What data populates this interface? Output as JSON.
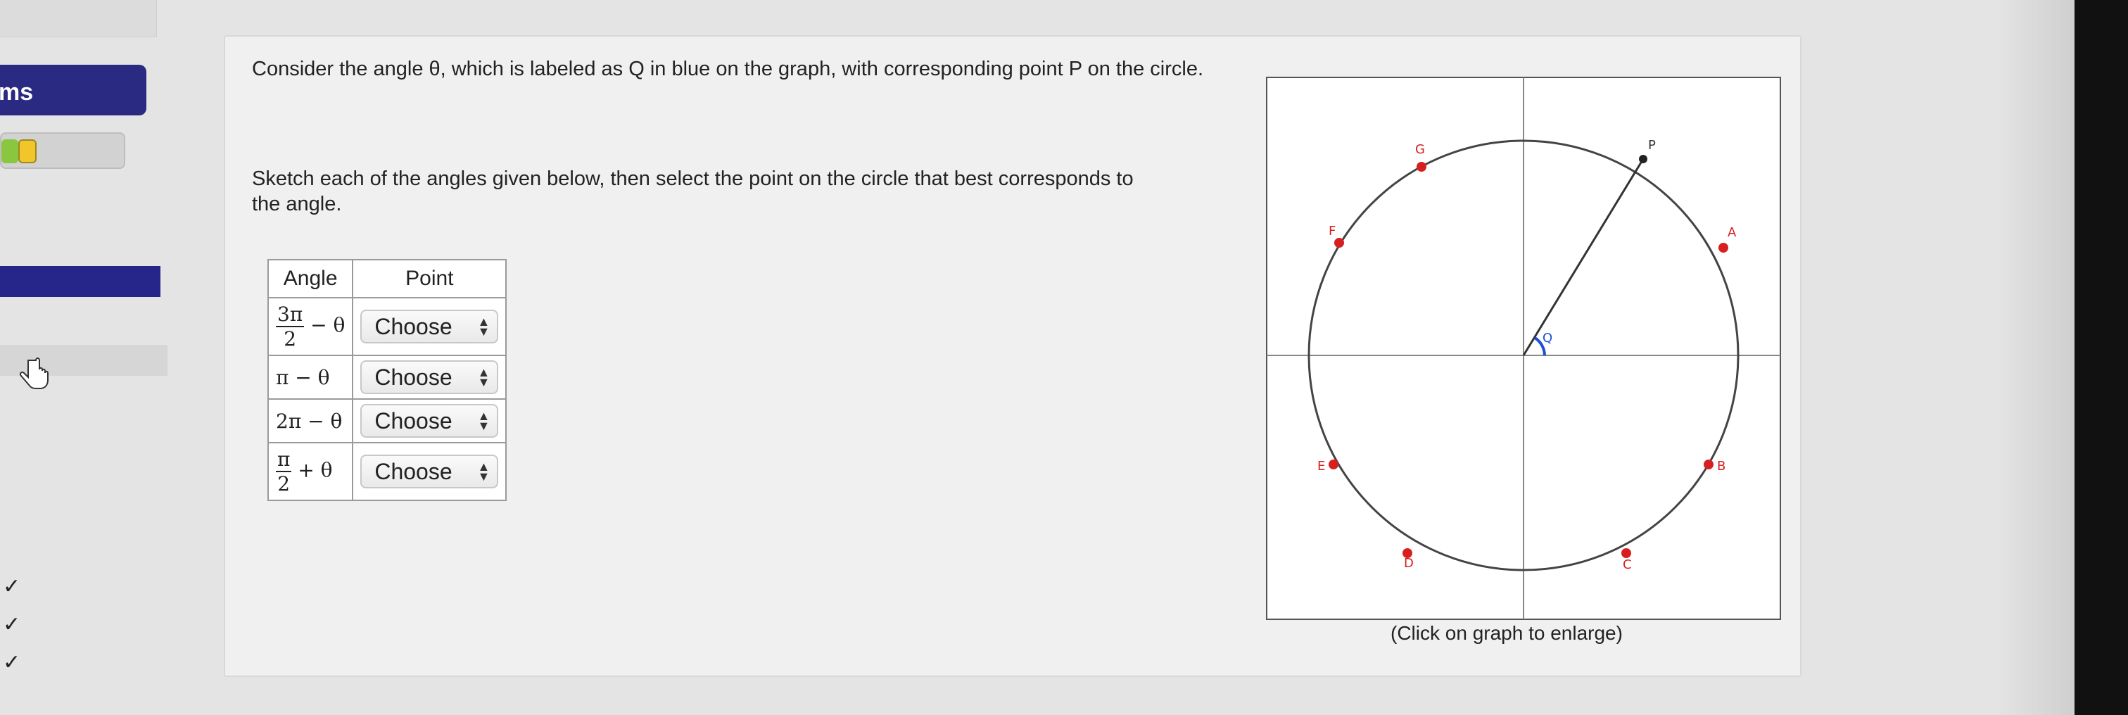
{
  "sidebar": {
    "tab_label": "ms",
    "progress_percent": 28,
    "checks": [
      "✓",
      "✓",
      "✓"
    ]
  },
  "question": {
    "line1": "Consider the angle θ, which is labeled as Q in blue on the graph, with corresponding point P on the circle.",
    "line2": "Sketch each of the angles given below, then select the point on the circle that best corresponds to the angle."
  },
  "table": {
    "headers": {
      "angle": "Angle",
      "point": "Point"
    },
    "rows": [
      {
        "num": "3π",
        "den": "2",
        "rest": " − θ",
        "select": "Choose"
      },
      {
        "expr": "π − θ",
        "select": "Choose"
      },
      {
        "expr": "2π − θ",
        "select": "Choose"
      },
      {
        "num": "π",
        "den": "2",
        "rest": " + θ",
        "select": "Choose"
      }
    ]
  },
  "graph": {
    "points": [
      "G",
      "P",
      "A",
      "F",
      "E",
      "B",
      "D",
      "C"
    ],
    "angle_label": "Q",
    "caption": "(Click on graph to enlarge)"
  },
  "colors": {
    "accent": "#2a2a82",
    "point_red": "#d62020",
    "angle_blue": "#1a4fd8"
  }
}
